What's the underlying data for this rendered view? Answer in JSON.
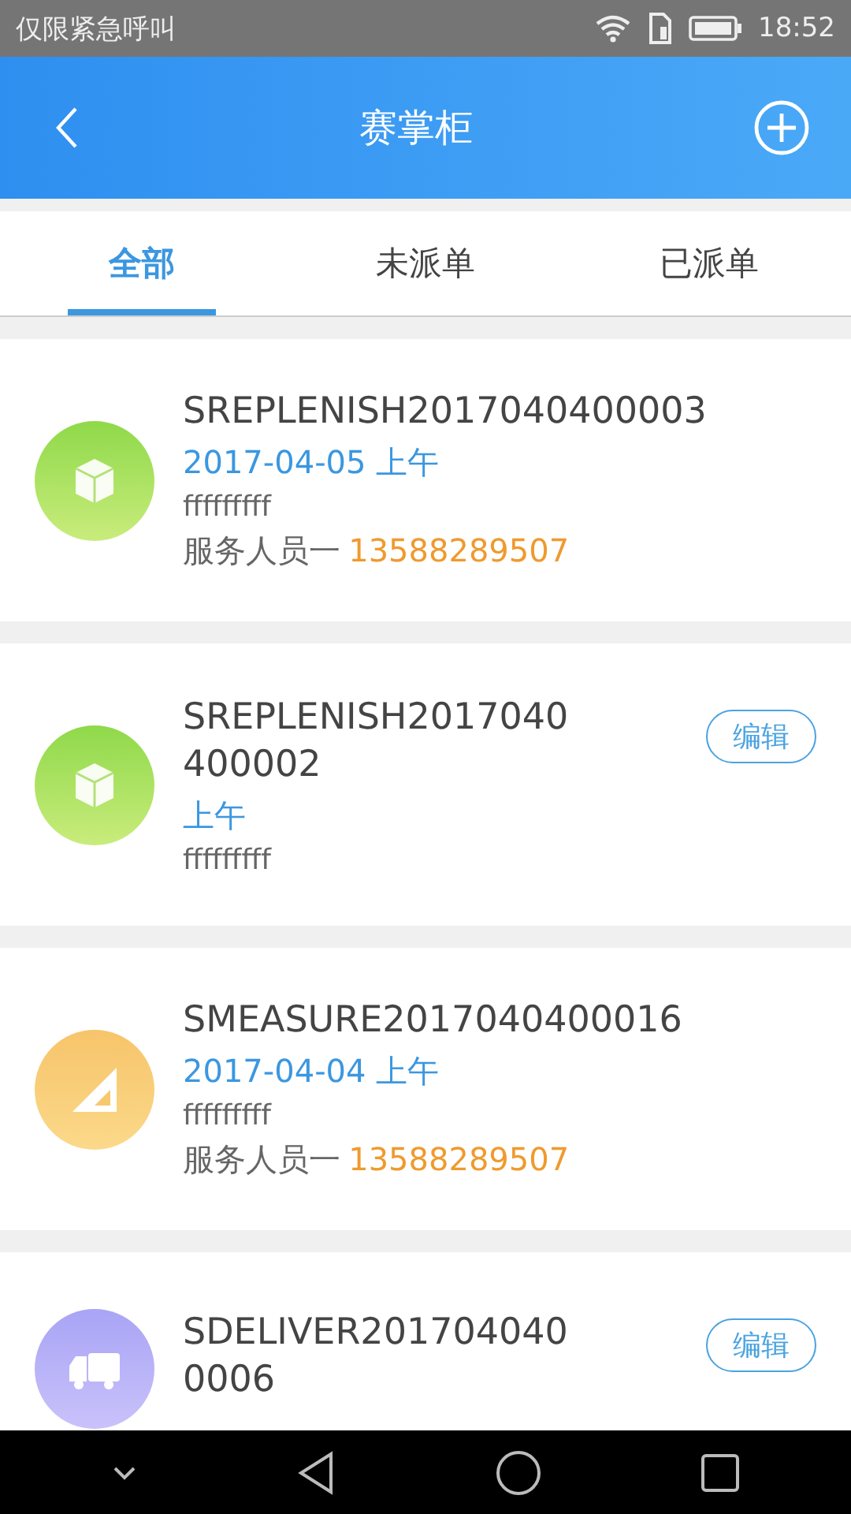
{
  "status_bar": {
    "carrier": "仅限紧急呼叫",
    "time": "18:52"
  },
  "header": {
    "title": "赛掌柜"
  },
  "tabs": [
    {
      "label": "全部",
      "selected": true
    },
    {
      "label": "未派单",
      "selected": false
    },
    {
      "label": "已派单",
      "selected": false
    }
  ],
  "orders": [
    {
      "kind": "box",
      "title": "SREPLENISH2017040400003",
      "date": "2017-04-05 上午",
      "note": "fffffffff",
      "staff": "服务人员一",
      "phone": "13588289507"
    },
    {
      "kind": "box",
      "title": "SREPLENISH2017040400002",
      "date": "上午",
      "note": "fffffffff",
      "edit_button": "编辑"
    },
    {
      "kind": "ruler",
      "title": "SMEASURE2017040400016",
      "date": "2017-04-04 上午",
      "note": "fffffffff",
      "staff": "服务人员一",
      "phone": "13588289507"
    },
    {
      "kind": "truck",
      "title": "SDELIVER2017040400006",
      "edit_button": "编辑"
    }
  ]
}
